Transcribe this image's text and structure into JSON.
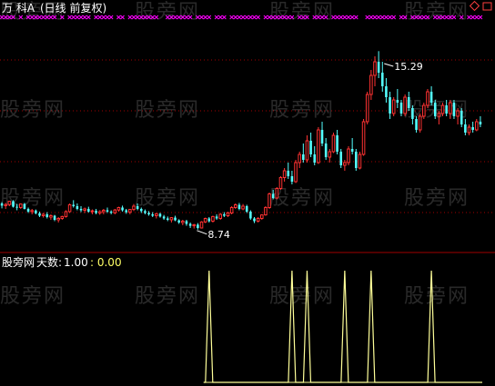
{
  "header": {
    "stock_name": "万 科A",
    "period_label": "(日线 前复权)"
  },
  "indicator": {
    "name": "股旁网",
    "param_label": "天数:",
    "param_value": "1.00",
    "value_text": ": 0.00"
  },
  "watermark": "股旁网",
  "colors": {
    "background": "#000000",
    "up": "#ff3232",
    "down": "#54ffff",
    "grid": "#a00000",
    "signal_marker": "#ff00ff",
    "indicator_line": "#ffff99",
    "text": "#c0c0c0"
  },
  "chart_data": [
    {
      "type": "candlestick",
      "title": "",
      "x_label": "",
      "y_label": "",
      "price_range": [
        8.1,
        16.5
      ],
      "grid": "horizontal dotted",
      "annotations": [
        {
          "label": "15.29",
          "index": 101
        },
        {
          "label": "8.74",
          "index": 52
        }
      ],
      "signal_markers": "magenta x at top of price panel on most bars",
      "series": [
        {
          "values": [
            [
              9.7,
              9.75,
              9.52,
              9.62
            ],
            [
              9.62,
              9.72,
              9.5,
              9.66
            ],
            [
              9.66,
              9.8,
              9.6,
              9.78
            ],
            [
              9.78,
              9.82,
              9.55,
              9.58
            ],
            [
              9.58,
              9.68,
              9.45,
              9.55
            ],
            [
              9.55,
              9.7,
              9.5,
              9.68
            ],
            [
              9.68,
              9.72,
              9.48,
              9.5
            ],
            [
              9.5,
              9.55,
              9.35,
              9.4
            ],
            [
              9.4,
              9.5,
              9.3,
              9.44
            ],
            [
              9.44,
              9.48,
              9.3,
              9.34
            ],
            [
              9.34,
              9.4,
              9.2,
              9.25
            ],
            [
              9.25,
              9.35,
              9.18,
              9.3
            ],
            [
              9.3,
              9.38,
              9.15,
              9.2
            ],
            [
              9.2,
              9.3,
              9.1,
              9.25
            ],
            [
              9.25,
              9.28,
              9.05,
              9.1
            ],
            [
              9.1,
              9.2,
              9.0,
              9.15
            ],
            [
              9.15,
              9.25,
              9.1,
              9.22
            ],
            [
              9.22,
              9.45,
              9.18,
              9.4
            ],
            [
              9.4,
              9.7,
              9.35,
              9.65
            ],
            [
              9.65,
              9.82,
              9.55,
              9.6
            ],
            [
              9.6,
              9.7,
              9.45,
              9.5
            ],
            [
              9.5,
              9.6,
              9.38,
              9.45
            ],
            [
              9.45,
              9.55,
              9.35,
              9.5
            ],
            [
              9.5,
              9.58,
              9.36,
              9.4
            ],
            [
              9.4,
              9.48,
              9.3,
              9.43
            ],
            [
              9.43,
              9.5,
              9.3,
              9.35
            ],
            [
              9.35,
              9.45,
              9.28,
              9.4
            ],
            [
              9.4,
              9.5,
              9.3,
              9.45
            ],
            [
              9.45,
              9.55,
              9.35,
              9.4
            ],
            [
              9.4,
              9.45,
              9.3,
              9.36
            ],
            [
              9.36,
              9.5,
              9.3,
              9.46
            ],
            [
              9.46,
              9.58,
              9.4,
              9.55
            ],
            [
              9.55,
              9.62,
              9.4,
              9.45
            ],
            [
              9.45,
              9.5,
              9.32,
              9.38
            ],
            [
              9.38,
              9.5,
              9.3,
              9.48
            ],
            [
              9.48,
              9.68,
              9.42,
              9.6
            ],
            [
              9.6,
              9.7,
              9.45,
              9.5
            ],
            [
              9.5,
              9.55,
              9.35,
              9.42
            ],
            [
              9.42,
              9.48,
              9.3,
              9.35
            ],
            [
              9.35,
              9.42,
              9.25,
              9.3
            ],
            [
              9.3,
              9.38,
              9.2,
              9.25
            ],
            [
              9.25,
              9.35,
              9.15,
              9.32
            ],
            [
              9.32,
              9.36,
              9.18,
              9.22
            ],
            [
              9.22,
              9.28,
              9.1,
              9.15
            ],
            [
              9.15,
              9.22,
              9.05,
              9.1
            ],
            [
              9.1,
              9.2,
              9.0,
              9.18
            ],
            [
              9.18,
              9.25,
              9.05,
              9.08
            ],
            [
              9.08,
              9.12,
              8.95,
              9.0
            ],
            [
              9.0,
              9.1,
              8.9,
              9.05
            ],
            [
              9.05,
              9.1,
              8.88,
              8.95
            ],
            [
              8.95,
              9.0,
              8.8,
              8.88
            ],
            [
              8.88,
              8.95,
              8.78,
              8.92
            ],
            [
              8.92,
              8.98,
              8.74,
              8.8
            ],
            [
              8.8,
              9.05,
              8.78,
              9.02
            ],
            [
              9.02,
              9.18,
              8.98,
              9.15
            ],
            [
              9.15,
              9.2,
              9.0,
              9.05
            ],
            [
              9.05,
              9.25,
              9.0,
              9.22
            ],
            [
              9.22,
              9.3,
              9.1,
              9.15
            ],
            [
              9.15,
              9.35,
              9.1,
              9.3
            ],
            [
              9.3,
              9.38,
              9.2,
              9.25
            ],
            [
              9.25,
              9.4,
              9.2,
              9.35
            ],
            [
              9.35,
              9.6,
              9.3,
              9.55
            ],
            [
              9.55,
              9.7,
              9.5,
              9.65
            ],
            [
              9.65,
              9.72,
              9.45,
              9.5
            ],
            [
              9.5,
              9.68,
              9.45,
              9.6
            ],
            [
              9.6,
              9.65,
              9.35,
              9.4
            ],
            [
              9.4,
              9.45,
              9.1,
              9.15
            ],
            [
              9.15,
              9.2,
              8.98,
              9.05
            ],
            [
              9.05,
              9.2,
              9.0,
              9.15
            ],
            [
              9.15,
              9.3,
              9.1,
              9.28
            ],
            [
              9.28,
              9.6,
              9.25,
              9.55
            ],
            [
              9.55,
              10.1,
              9.5,
              10.05
            ],
            [
              10.05,
              10.2,
              9.85,
              9.9
            ],
            [
              9.9,
              10.3,
              9.85,
              10.25
            ],
            [
              10.25,
              10.7,
              10.2,
              10.65
            ],
            [
              10.65,
              11.0,
              10.5,
              10.9
            ],
            [
              10.9,
              11.2,
              10.6,
              10.7
            ],
            [
              10.7,
              10.9,
              10.4,
              10.5
            ],
            [
              10.5,
              11.3,
              10.45,
              11.2
            ],
            [
              11.2,
              11.6,
              11.0,
              11.5
            ],
            [
              11.5,
              11.9,
              11.2,
              11.3
            ],
            [
              11.3,
              12.2,
              11.2,
              12.0
            ],
            [
              12.0,
              12.3,
              11.4,
              11.5
            ],
            [
              11.5,
              11.8,
              11.1,
              11.2
            ],
            [
              11.2,
              12.5,
              11.15,
              12.4
            ],
            [
              12.4,
              12.7,
              11.8,
              11.9
            ],
            [
              11.9,
              12.1,
              11.3,
              11.4
            ],
            [
              11.4,
              11.7,
              11.2,
              11.6
            ],
            [
              11.6,
              12.3,
              11.55,
              12.2
            ],
            [
              12.2,
              12.4,
              11.5,
              11.6
            ],
            [
              11.6,
              11.7,
              11.0,
              11.1
            ],
            [
              11.1,
              11.3,
              10.9,
              11.2
            ],
            [
              11.2,
              11.8,
              11.1,
              11.7
            ],
            [
              11.7,
              12.1,
              11.5,
              11.6
            ],
            [
              11.6,
              11.7,
              10.9,
              11.0
            ],
            [
              11.0,
              11.6,
              10.95,
              11.5
            ],
            [
              11.5,
              12.8,
              11.45,
              12.7
            ],
            [
              12.7,
              13.8,
              12.6,
              13.7
            ],
            [
              13.7,
              14.6,
              13.5,
              14.4
            ],
            [
              14.4,
              15.1,
              14.0,
              14.9
            ],
            [
              14.9,
              15.29,
              14.3,
              14.5
            ],
            [
              14.5,
              14.9,
              13.8,
              14.0
            ],
            [
              14.0,
              14.3,
              13.4,
              13.6
            ],
            [
              13.6,
              13.8,
              12.8,
              13.0
            ],
            [
              13.0,
              13.6,
              12.9,
              13.5
            ],
            [
              13.5,
              13.9,
              13.2,
              13.4
            ],
            [
              13.4,
              13.5,
              12.9,
              13.0
            ],
            [
              13.0,
              13.7,
              12.9,
              13.6
            ],
            [
              13.6,
              13.8,
              13.1,
              13.2
            ],
            [
              13.2,
              13.3,
              12.6,
              12.8
            ],
            [
              12.8,
              12.9,
              12.3,
              12.4
            ],
            [
              12.4,
              13.0,
              12.3,
              12.9
            ],
            [
              12.9,
              13.4,
              12.8,
              13.3
            ],
            [
              13.3,
              13.9,
              13.2,
              13.8
            ],
            [
              13.8,
              14.0,
              13.3,
              13.4
            ],
            [
              13.4,
              13.5,
              12.8,
              12.9
            ],
            [
              12.9,
              13.1,
              12.6,
              13.0
            ],
            [
              13.0,
              13.4,
              12.9,
              13.3
            ],
            [
              13.3,
              13.5,
              12.9,
              13.0
            ],
            [
              13.0,
              13.5,
              12.8,
              13.4
            ],
            [
              13.4,
              13.5,
              12.8,
              12.9
            ],
            [
              12.9,
              13.2,
              12.6,
              13.1
            ],
            [
              13.1,
              13.2,
              12.5,
              12.6
            ],
            [
              12.6,
              12.8,
              12.2,
              12.3
            ],
            [
              12.3,
              12.6,
              12.2,
              12.5
            ],
            [
              12.5,
              12.7,
              12.3,
              12.4
            ],
            [
              12.4,
              12.8,
              12.35,
              12.7
            ],
            [
              12.7,
              12.9,
              12.5,
              12.6
            ]
          ]
        }
      ]
    },
    {
      "type": "line",
      "title": "",
      "x_label": "",
      "y_label": "",
      "y_range": [
        0,
        1
      ],
      "spike_indices": [
        55,
        77,
        81,
        91,
        98,
        114
      ],
      "spike_value": 1.0,
      "baseline_value": 0.0
    }
  ]
}
